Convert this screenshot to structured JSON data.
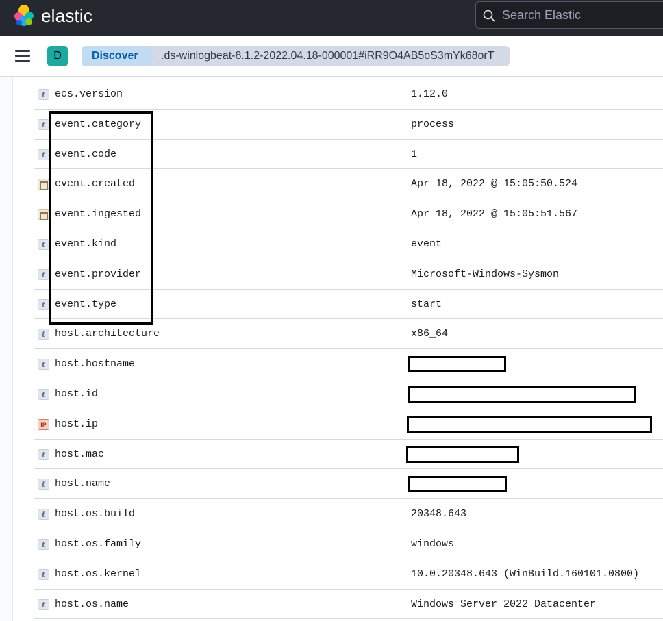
{
  "header": {
    "brand": "elastic",
    "search_placeholder": "Search Elastic"
  },
  "navbar": {
    "space_initial": "D",
    "breadcrumbs": [
      "Discover",
      ".ds-winlogbeat-8.1.2-2022.04.18-000001#iRR9O4AB5oS3mYk68orT"
    ]
  },
  "colors": {
    "header_bg": "#25282f",
    "space_avatar": "#1ba9a0",
    "crumb_active_bg": "#c3dbf2",
    "crumb_active_text": "#0061a6"
  },
  "fields": [
    {
      "type": "string",
      "icon": "t",
      "name": "ecs.version",
      "value": "1.12.0"
    },
    {
      "type": "string",
      "icon": "t",
      "name": "event.category",
      "value": "process"
    },
    {
      "type": "string",
      "icon": "t",
      "name": "event.code",
      "value": "1"
    },
    {
      "type": "date",
      "icon": "calendar-icon",
      "name": "event.created",
      "value": "Apr 18, 2022 @ 15:05:50.524"
    },
    {
      "type": "date",
      "icon": "calendar-icon",
      "name": "event.ingested",
      "value": "Apr 18, 2022 @ 15:05:51.567"
    },
    {
      "type": "string",
      "icon": "t",
      "name": "event.kind",
      "value": "event"
    },
    {
      "type": "string",
      "icon": "t",
      "name": "event.provider",
      "value": "Microsoft-Windows-Sysmon"
    },
    {
      "type": "string",
      "icon": "t",
      "name": "event.type",
      "value": "start"
    },
    {
      "type": "string",
      "icon": "t",
      "name": "host.architecture",
      "value": "x86_64"
    },
    {
      "type": "string",
      "icon": "t",
      "name": "host.hostname",
      "value": null
    },
    {
      "type": "string",
      "icon": "t",
      "name": "host.id",
      "value": null
    },
    {
      "type": "ip",
      "icon": "IP",
      "name": "host.ip",
      "value": null
    },
    {
      "type": "string",
      "icon": "t",
      "name": "host.mac",
      "value": null
    },
    {
      "type": "string",
      "icon": "t",
      "name": "host.name",
      "value": null
    },
    {
      "type": "string",
      "icon": "t",
      "name": "host.os.build",
      "value": "20348.643"
    },
    {
      "type": "string",
      "icon": "t",
      "name": "host.os.family",
      "value": "windows"
    },
    {
      "type": "string",
      "icon": "t",
      "name": "host.os.kernel",
      "value": "10.0.20348.643 (WinBuild.160101.0800)"
    },
    {
      "type": "string",
      "icon": "t",
      "name": "host.os.name",
      "value": "Windows Server 2022 Datacenter"
    }
  ]
}
